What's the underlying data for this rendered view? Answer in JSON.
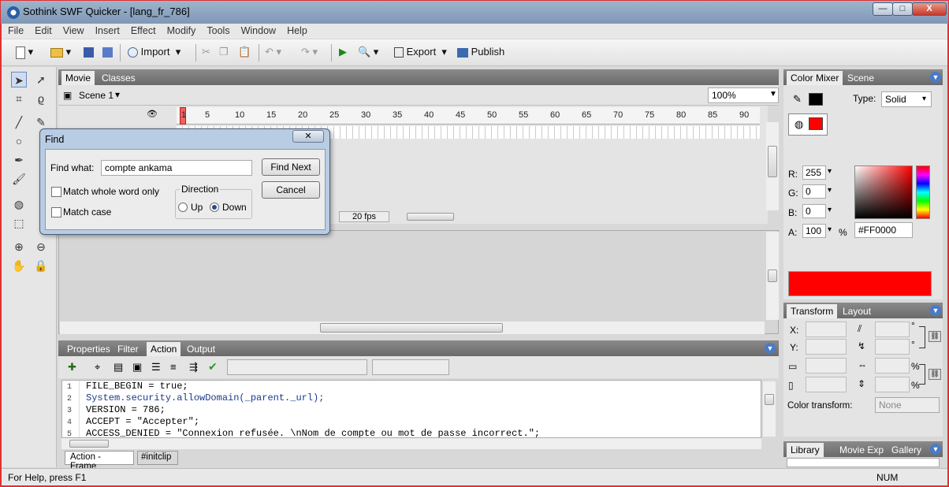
{
  "window": {
    "title": "Sothink SWF Quicker - [lang_fr_786]",
    "controls": [
      "—",
      "□",
      "X"
    ]
  },
  "menu": [
    "File",
    "Edit",
    "View",
    "Insert",
    "Effect",
    "Modify",
    "Tools",
    "Window",
    "Help"
  ],
  "toolbar": {
    "import": "Import",
    "export": "Export",
    "publish": "Publish"
  },
  "stage_tabs": [
    "Movie",
    "Classes"
  ],
  "scene": {
    "name": "Scene 1",
    "zoom": "100%"
  },
  "timeline": {
    "ticks": [
      "1",
      "5",
      "10",
      "15",
      "20",
      "25",
      "30",
      "35",
      "40",
      "45",
      "50",
      "55",
      "60",
      "65",
      "70",
      "75",
      "80",
      "85",
      "90"
    ],
    "fps": "20 fps"
  },
  "find_dialog": {
    "title": "Find",
    "find_what_label": "Find what:",
    "find_what_value": "compte ankama",
    "find_next": "Find Next",
    "cancel": "Cancel",
    "match_whole_word": "Match whole word only",
    "match_case": "Match case",
    "direction_label": "Direction",
    "up": "Up",
    "down": "Down",
    "close": "✕"
  },
  "bottom_tabs": [
    "Properties",
    "Filter",
    "Action",
    "Output"
  ],
  "code_lines": [
    {
      "n": "1",
      "text": "FILE_BEGIN = true;"
    },
    {
      "n": "2",
      "text": "System.security.allowDomain(_parent._url);"
    },
    {
      "n": "3",
      "text": "VERSION = 786;"
    },
    {
      "n": "4",
      "text": "ACCEPT = \"Accepter\";"
    },
    {
      "n": "5",
      "text": "ACCESS_DENIED = \"Connexion refusée. \\nNom de compte ou mot de passe incorrect.\";"
    }
  ],
  "code_tabs": [
    "Action - Frame",
    "#initclip"
  ],
  "color_mixer": {
    "tabs": [
      "Color Mixer",
      "Scene"
    ],
    "type_label": "Type:",
    "type_value": "Solid",
    "r_label": "R:",
    "r": "255",
    "g_label": "G:",
    "g": "0",
    "b_label": "B:",
    "b": "0",
    "a_label": "A:",
    "a": "100",
    "pct": "%",
    "hex": "#FF0000",
    "color": "#ff0000"
  },
  "transform": {
    "tabs": [
      "Transform",
      "Layout"
    ],
    "x": "X:",
    "y": "Y:",
    "pct1": "%",
    "pct2": "%",
    "deg1": "°",
    "deg2": "°",
    "color_transform_label": "Color transform:",
    "color_transform_value": "None"
  },
  "library_tabs": [
    "Library",
    "Movie Exp",
    "Gallery"
  ],
  "status": {
    "help": "For Help, press F1",
    "num": "NUM"
  }
}
